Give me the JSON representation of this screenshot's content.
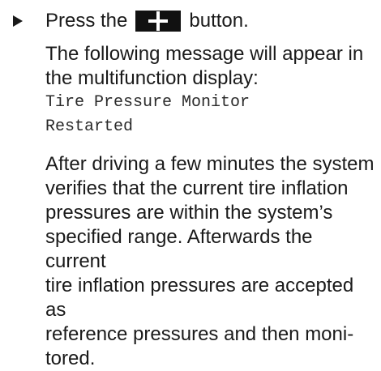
{
  "step": {
    "prefix": "Press the",
    "button_icon": "plus-icon",
    "suffix": "button."
  },
  "message_intro": {
    "lines": [
      "The following message will appear in",
      "the multifunction display:"
    ]
  },
  "display_message": {
    "lines": [
      "Tire Pressure Monitor",
      "Restarted"
    ]
  },
  "body_text": {
    "lines": [
      "After driving a few minutes the system",
      "verifies that the current tire inflation",
      "pressures are within the system’s",
      "specified range. Afterwards the current",
      "tire inflation pressures are accepted as",
      "reference pressures and then moni-",
      "tored."
    ]
  }
}
